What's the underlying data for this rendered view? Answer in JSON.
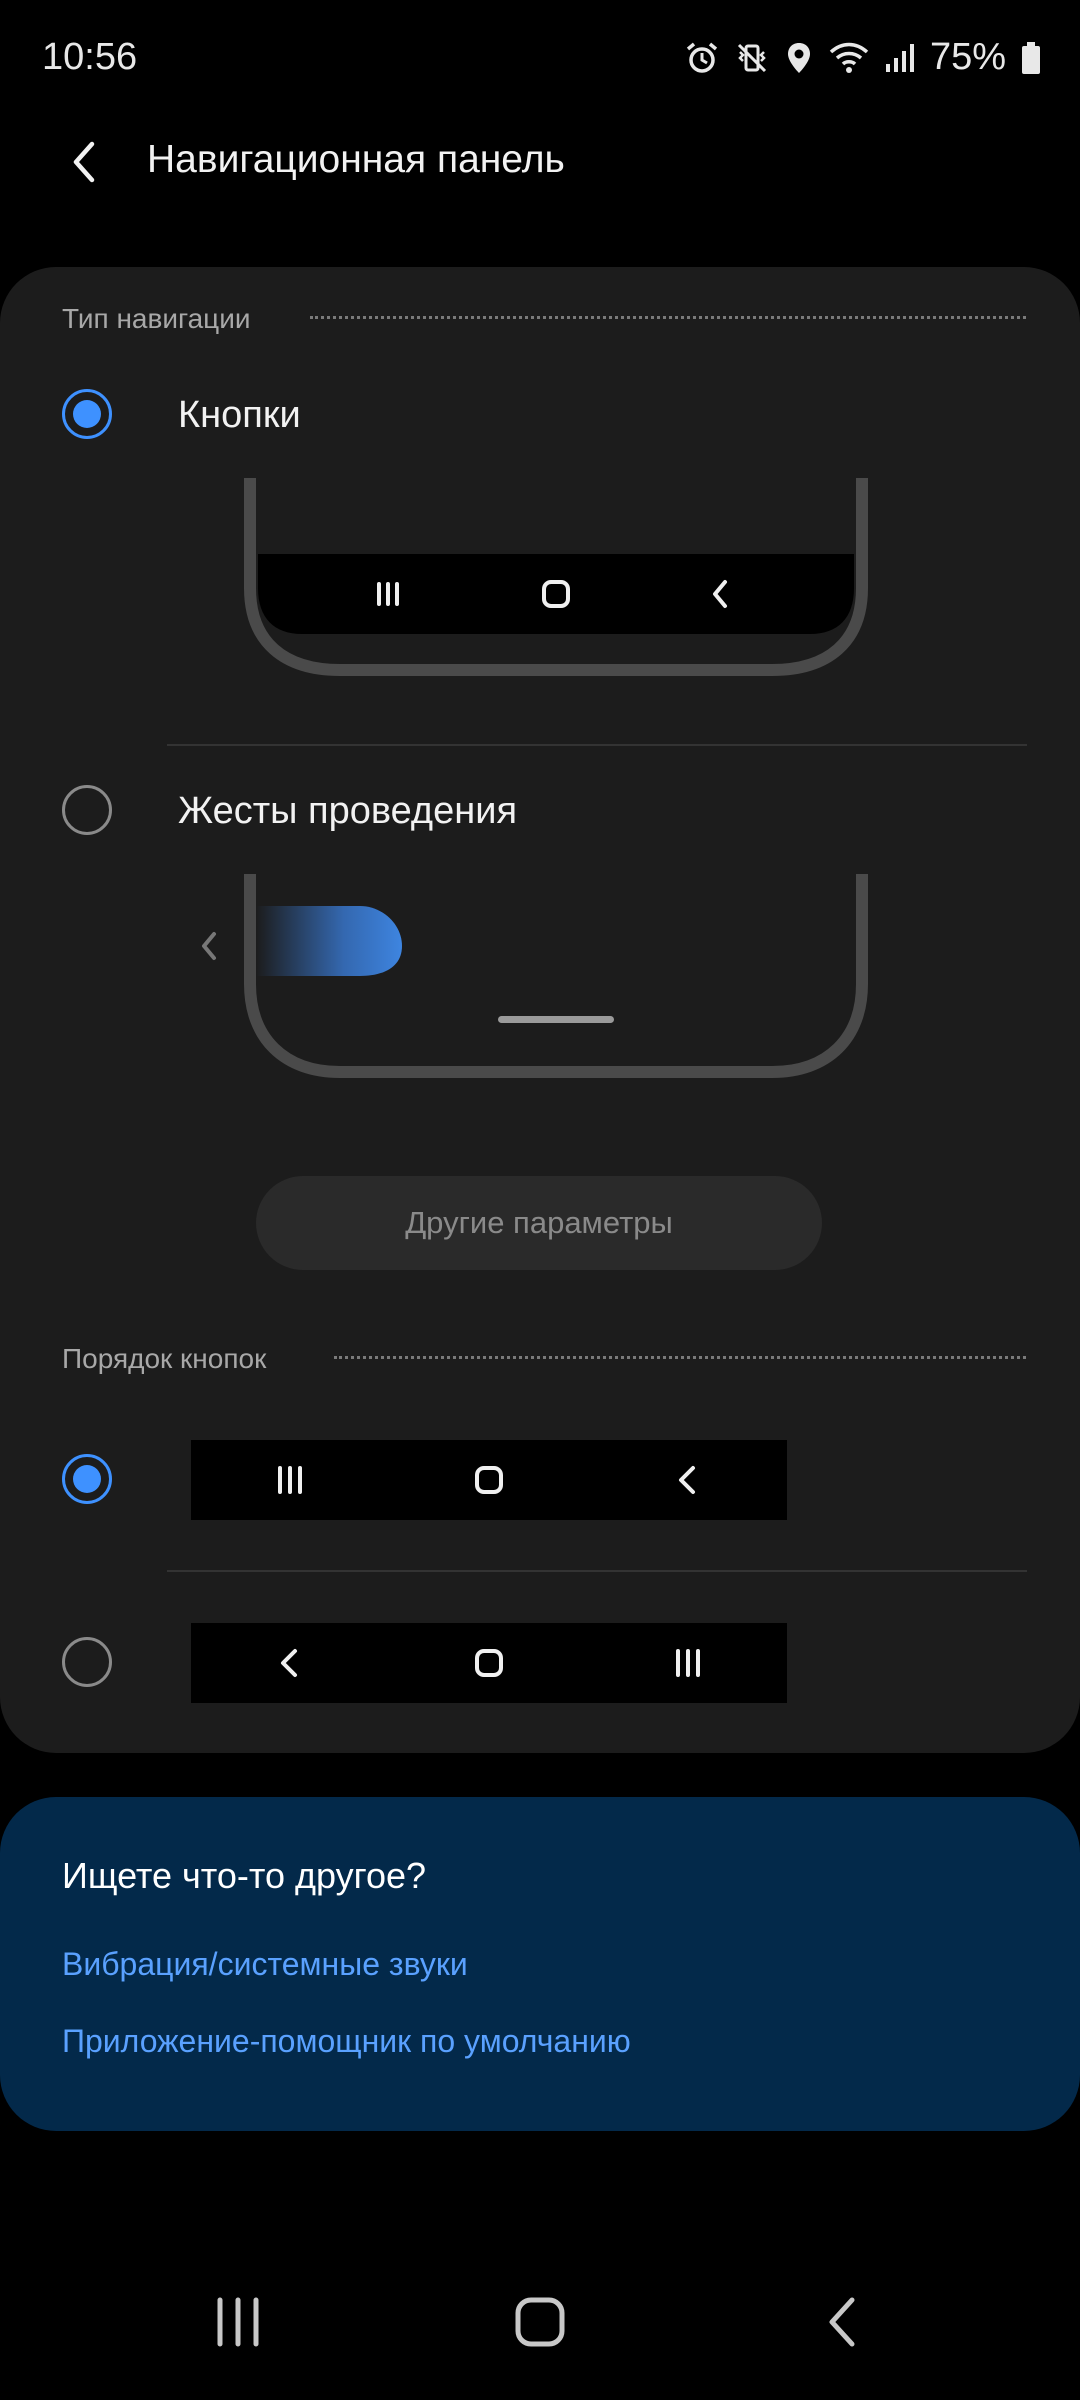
{
  "status_bar": {
    "time": "10:56",
    "battery_percent": "75%",
    "icons": [
      "alarm-icon",
      "vibrate-icon",
      "location-icon",
      "wifi-icon",
      "signal-icon",
      "battery-icon"
    ]
  },
  "header": {
    "title": "Навигационная панель"
  },
  "navigation_type": {
    "section_label": "Тип навигации",
    "options": [
      {
        "label": "Кнопки",
        "selected": true
      },
      {
        "label": "Жесты проведения",
        "selected": false
      }
    ],
    "more_button_label": "Другие параметры"
  },
  "button_order": {
    "section_label": "Порядок кнопок",
    "options": [
      {
        "selected": true,
        "icons": [
          "recents-icon",
          "home-icon",
          "back-icon"
        ]
      },
      {
        "selected": false,
        "icons": [
          "back-icon",
          "home-icon",
          "recents-icon"
        ]
      }
    ]
  },
  "help_card": {
    "title": "Ищете что-то другое?",
    "links": [
      "Вибрация/системные звуки",
      "Приложение-помощник по умолчанию"
    ]
  },
  "colors": {
    "accent": "#3e91ff",
    "link": "#5aa1ff",
    "card": "#1c1c1c",
    "help_card": "#03294a"
  }
}
